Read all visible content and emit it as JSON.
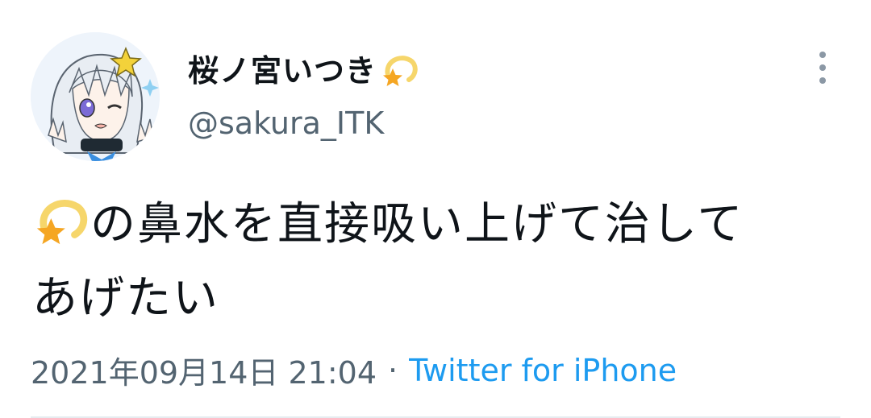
{
  "user": {
    "display_name": "桜ノ宮いつき",
    "name_emoji": "dizzy-star-icon",
    "handle": "@sakura_ITK",
    "avatar": "anime-girl-avatar"
  },
  "tweet": {
    "leading_emoji": "dizzy-star-icon",
    "text_line1": "の鼻水を直接吸い上げて治して",
    "text_line2": "あげたい"
  },
  "meta": {
    "timestamp": "2021年09月14日 21:04",
    "separator": "·",
    "source": "Twitter for iPhone"
  },
  "colors": {
    "text": "#0f1419",
    "secondary": "#536471",
    "link": "#1d9bf0",
    "divider": "#e6ecf0"
  },
  "more_icon": "more-vertical-icon"
}
